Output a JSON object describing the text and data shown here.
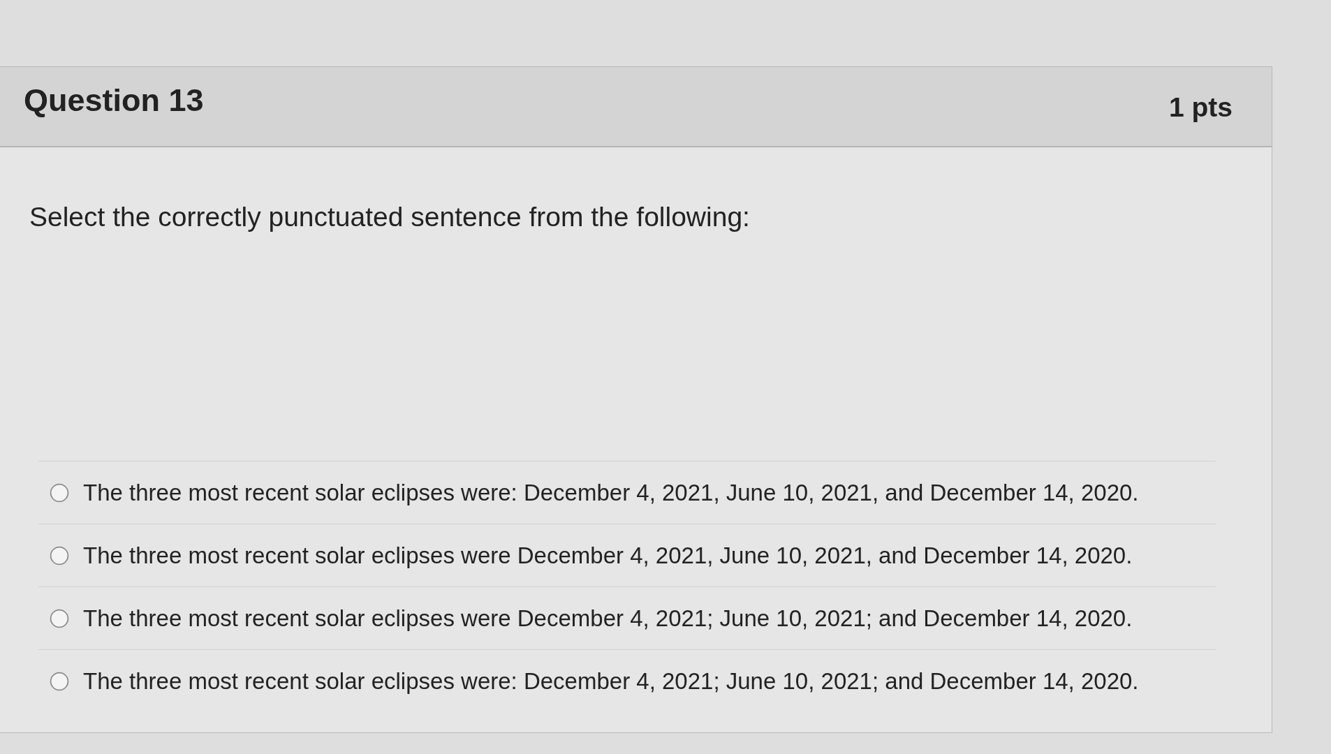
{
  "question": {
    "title": "Question 13",
    "points": "1 pts",
    "prompt": "Select the correctly punctuated sentence from the following:",
    "options": [
      {
        "text": "The three most recent solar eclipses were: December 4, 2021, June 10, 2021, and December 14, 2020.",
        "selected": false
      },
      {
        "text": "The three most recent solar eclipses were December 4, 2021, June 10, 2021, and December 14, 2020.",
        "selected": false
      },
      {
        "text": "The three most recent solar eclipses were December 4, 2021; June 10, 2021; and December 14, 2020.",
        "selected": false
      },
      {
        "text": "The three most recent solar eclipses were: December 4, 2021; June 10, 2021; and December 14, 2020.",
        "selected": false
      }
    ]
  }
}
